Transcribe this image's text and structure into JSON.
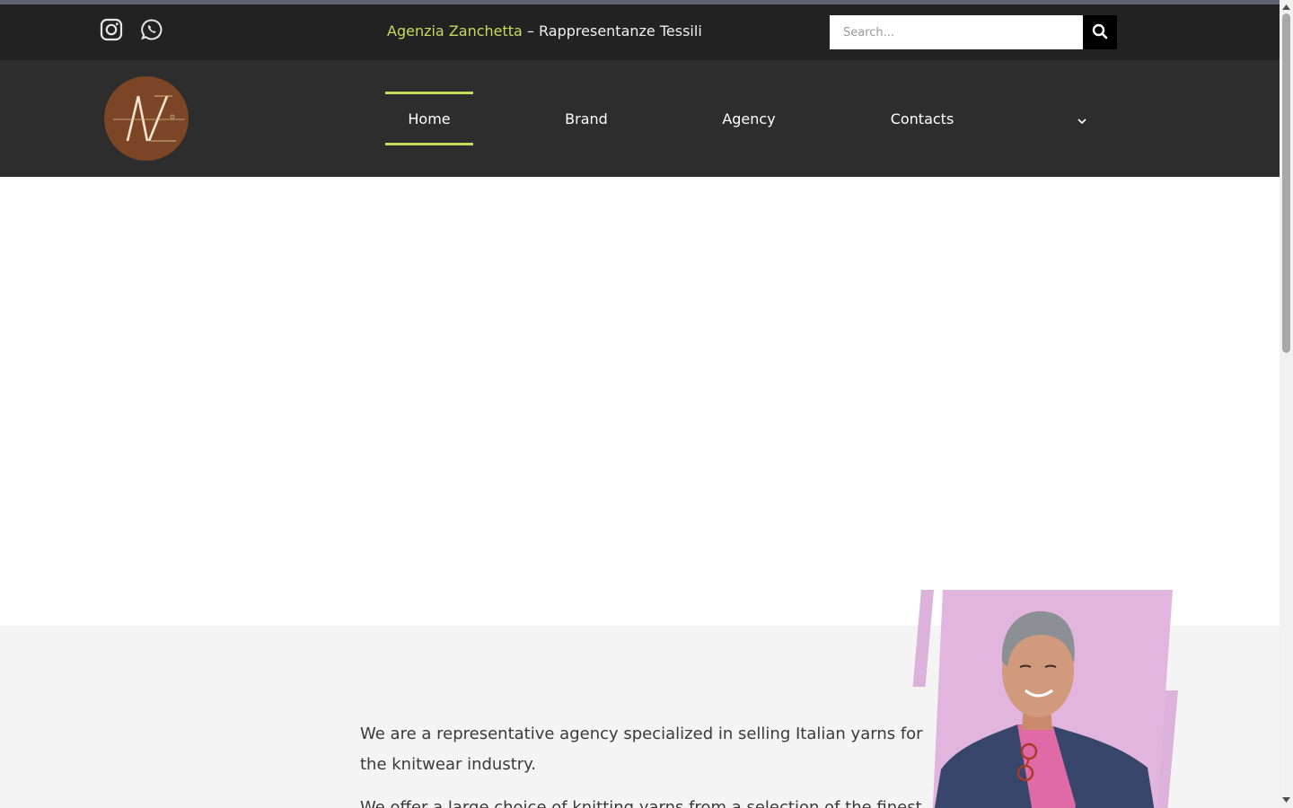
{
  "topbar": {
    "tagline_brand": "Agenzia Zanchetta",
    "tagline_rest": " – Rappresentanze Tessili",
    "social": [
      {
        "name": "instagram-icon"
      },
      {
        "name": "whatsapp-icon"
      }
    ],
    "search": {
      "placeholder": "Search...",
      "value": ""
    }
  },
  "nav": {
    "items": [
      {
        "label": "Home",
        "active": true
      },
      {
        "label": "Brand",
        "active": false
      },
      {
        "label": "Agency",
        "active": false
      },
      {
        "label": "Contacts",
        "active": false
      }
    ]
  },
  "about": {
    "paragraph1": "We are a representative agency specialized in selling Italian yarns for the knitwear industry.",
    "paragraph2": "We offer a large choice of knitting yarns from a selection of the finest"
  },
  "colors": {
    "accent": "#c8da5b",
    "topbar_bg": "#222222",
    "navbar_bg": "#2d2d2d",
    "logo_bg": "#7b4526",
    "portrait_pink": "#e2b5df",
    "about_bg": "#f4f4f4"
  }
}
